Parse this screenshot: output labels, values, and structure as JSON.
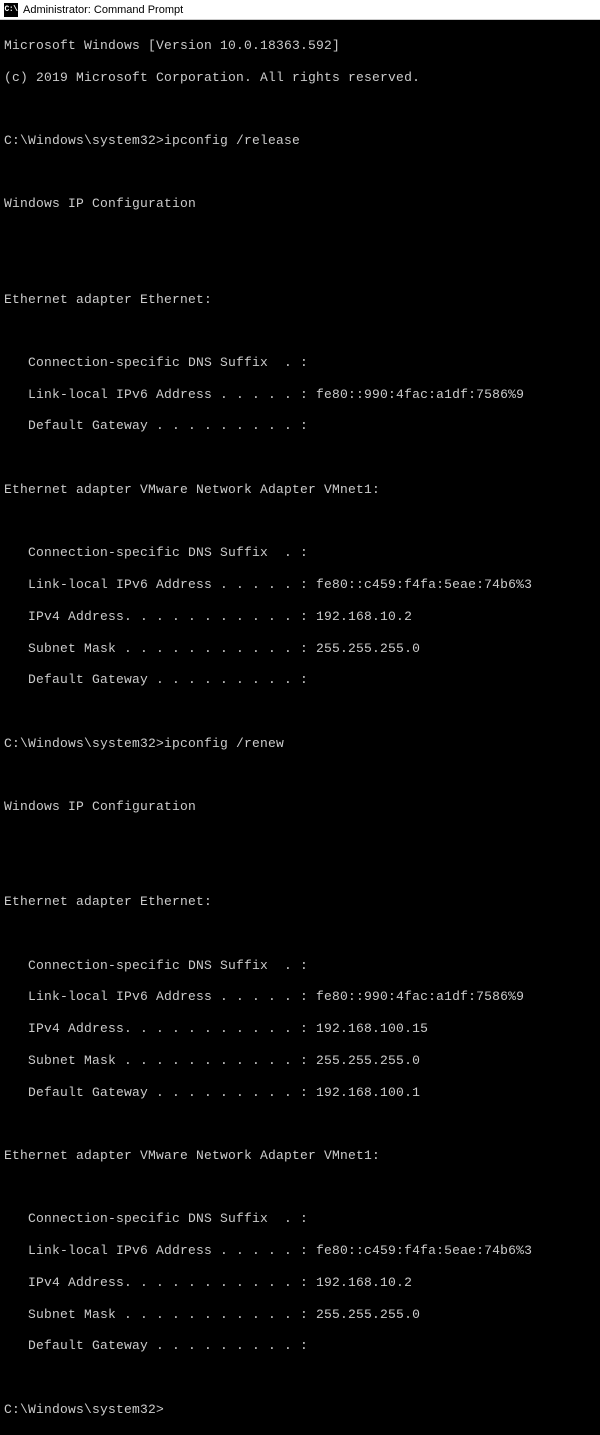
{
  "window": {
    "icon_text": "C:\\",
    "title": "Administrator: Command Prompt"
  },
  "header": {
    "version_line": "Microsoft Windows [Version 10.0.18363.592]",
    "copyright_line": "(c) 2019 Microsoft Corporation. All rights reserved."
  },
  "prompts": {
    "p1": "C:\\Windows\\system32>ipconfig /release",
    "p2": "C:\\Windows\\system32>ipconfig /renew",
    "p3": "C:\\Windows\\system32>"
  },
  "sections": {
    "ipconfig_header": "Windows IP Configuration",
    "eth_header": "Ethernet adapter Ethernet:",
    "vmnet_header": "Ethernet adapter VMware Network Adapter VMnet1:"
  },
  "release": {
    "eth": {
      "dns": "   Connection-specific DNS Suffix  . :",
      "ipv6": "   Link-local IPv6 Address . . . . . : fe80::990:4fac:a1df:7586%9",
      "gw": "   Default Gateway . . . . . . . . . :"
    },
    "vmnet": {
      "dns": "   Connection-specific DNS Suffix  . :",
      "ipv6": "   Link-local IPv6 Address . . . . . : fe80::c459:f4fa:5eae:74b6%3",
      "ipv4": "   IPv4 Address. . . . . . . . . . . : 192.168.10.2",
      "mask": "   Subnet Mask . . . . . . . . . . . : 255.255.255.0",
      "gw": "   Default Gateway . . . . . . . . . :"
    }
  },
  "renew": {
    "eth": {
      "dns": "   Connection-specific DNS Suffix  . :",
      "ipv6": "   Link-local IPv6 Address . . . . . : fe80::990:4fac:a1df:7586%9",
      "ipv4": "   IPv4 Address. . . . . . . . . . . : 192.168.100.15",
      "mask": "   Subnet Mask . . . . . . . . . . . : 255.255.255.0",
      "gw": "   Default Gateway . . . . . . . . . : 192.168.100.1"
    },
    "vmnet": {
      "dns": "   Connection-specific DNS Suffix  . :",
      "ipv6": "   Link-local IPv6 Address . . . . . : fe80::c459:f4fa:5eae:74b6%3",
      "ipv4": "   IPv4 Address. . . . . . . . . . . : 192.168.10.2",
      "mask": "   Subnet Mask . . . . . . . . . . . : 255.255.255.0",
      "gw": "   Default Gateway . . . . . . . . . :"
    }
  }
}
